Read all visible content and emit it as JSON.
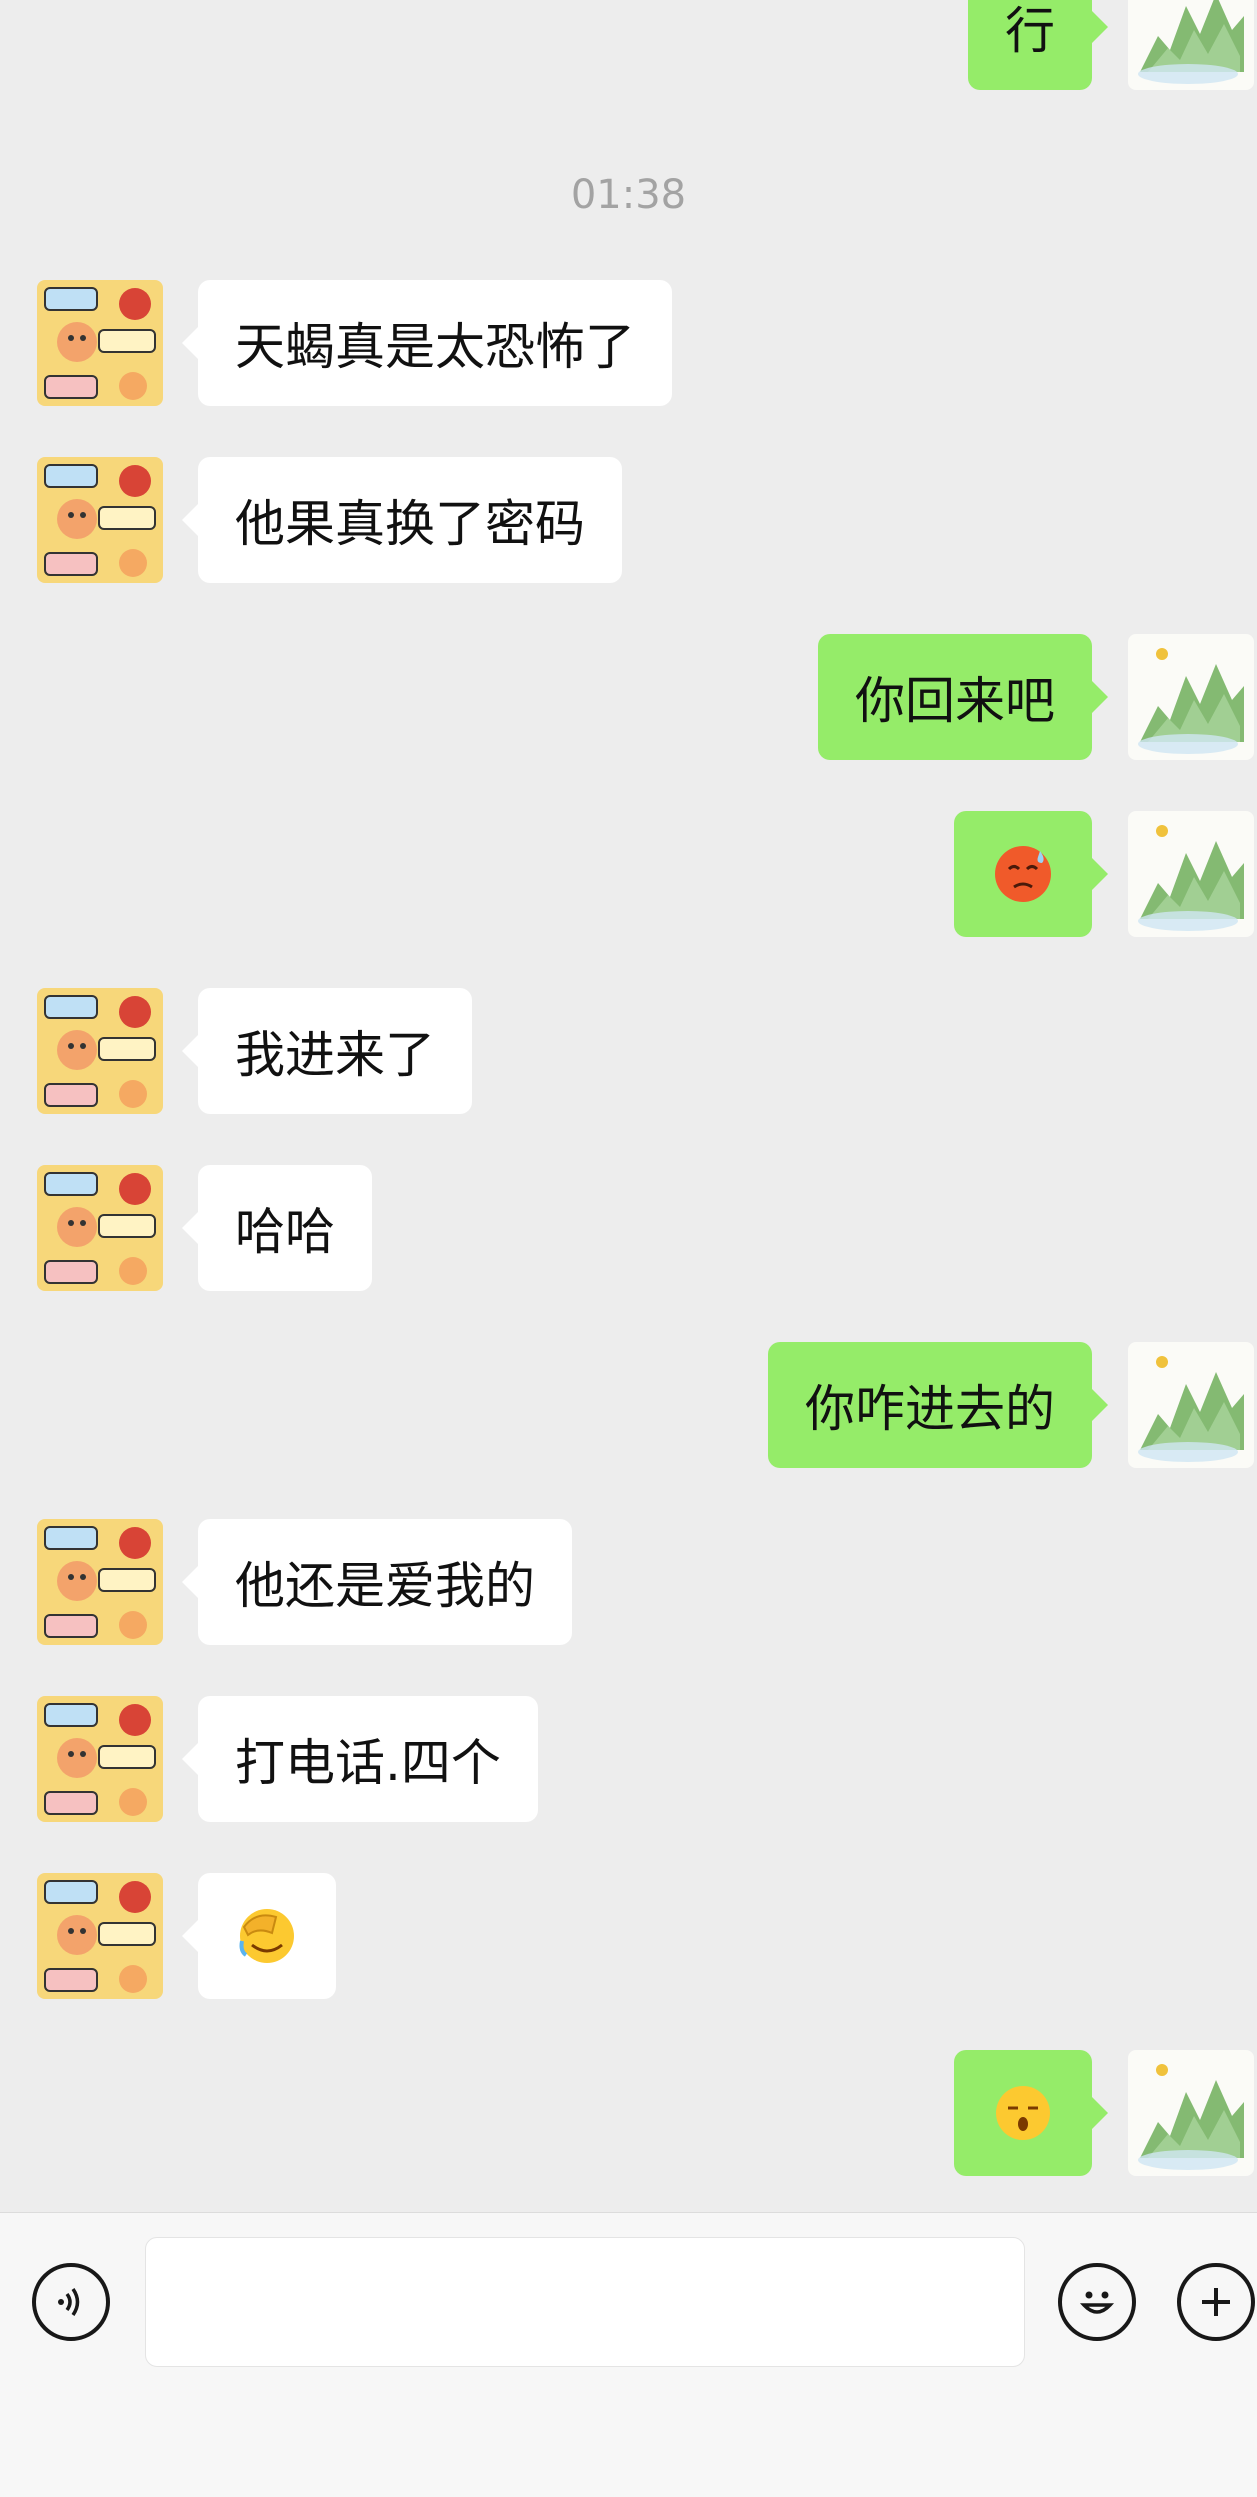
{
  "chat": {
    "timestamp": "01:38",
    "messages": [
      {
        "side": "right",
        "type": "text",
        "text": "行"
      },
      {
        "side": "left",
        "type": "text",
        "text": "天蝎真是太恐怖了"
      },
      {
        "side": "left",
        "type": "text",
        "text": "他果真换了密码"
      },
      {
        "side": "right",
        "type": "text",
        "text": "你回来吧"
      },
      {
        "side": "right",
        "type": "emoji",
        "emoji": "cold-sweat-face-emoji"
      },
      {
        "side": "left",
        "type": "text",
        "text": "我进来了"
      },
      {
        "side": "left",
        "type": "text",
        "text": "哈哈"
      },
      {
        "side": "right",
        "type": "text",
        "text": "你咋进去的"
      },
      {
        "side": "left",
        "type": "text",
        "text": "他还是爱我的"
      },
      {
        "side": "left",
        "type": "text",
        "text": "打电话.四个"
      },
      {
        "side": "left",
        "type": "emoji",
        "emoji": "facepalm-laughing-emoji"
      },
      {
        "side": "right",
        "type": "emoji",
        "emoji": "sleepy-snoring-face-emoji"
      }
    ],
    "contact_avatar": {
      "icon": "sticker-avatar",
      "tags": [
        "心态好",
        "情绪好",
        "身体好"
      ]
    },
    "self_avatar": {
      "icon": "landscape-painting-avatar"
    }
  },
  "toolbar": {
    "voice_icon": "voice-input-icon",
    "emoji_icon": "emoji-smile-icon",
    "plus_icon": "plus-icon",
    "input_value": ""
  },
  "colors": {
    "background": "#ededed",
    "sent_bubble": "#95ec69",
    "received_bubble": "#ffffff",
    "toolbar_bg": "#f7f7f7"
  }
}
